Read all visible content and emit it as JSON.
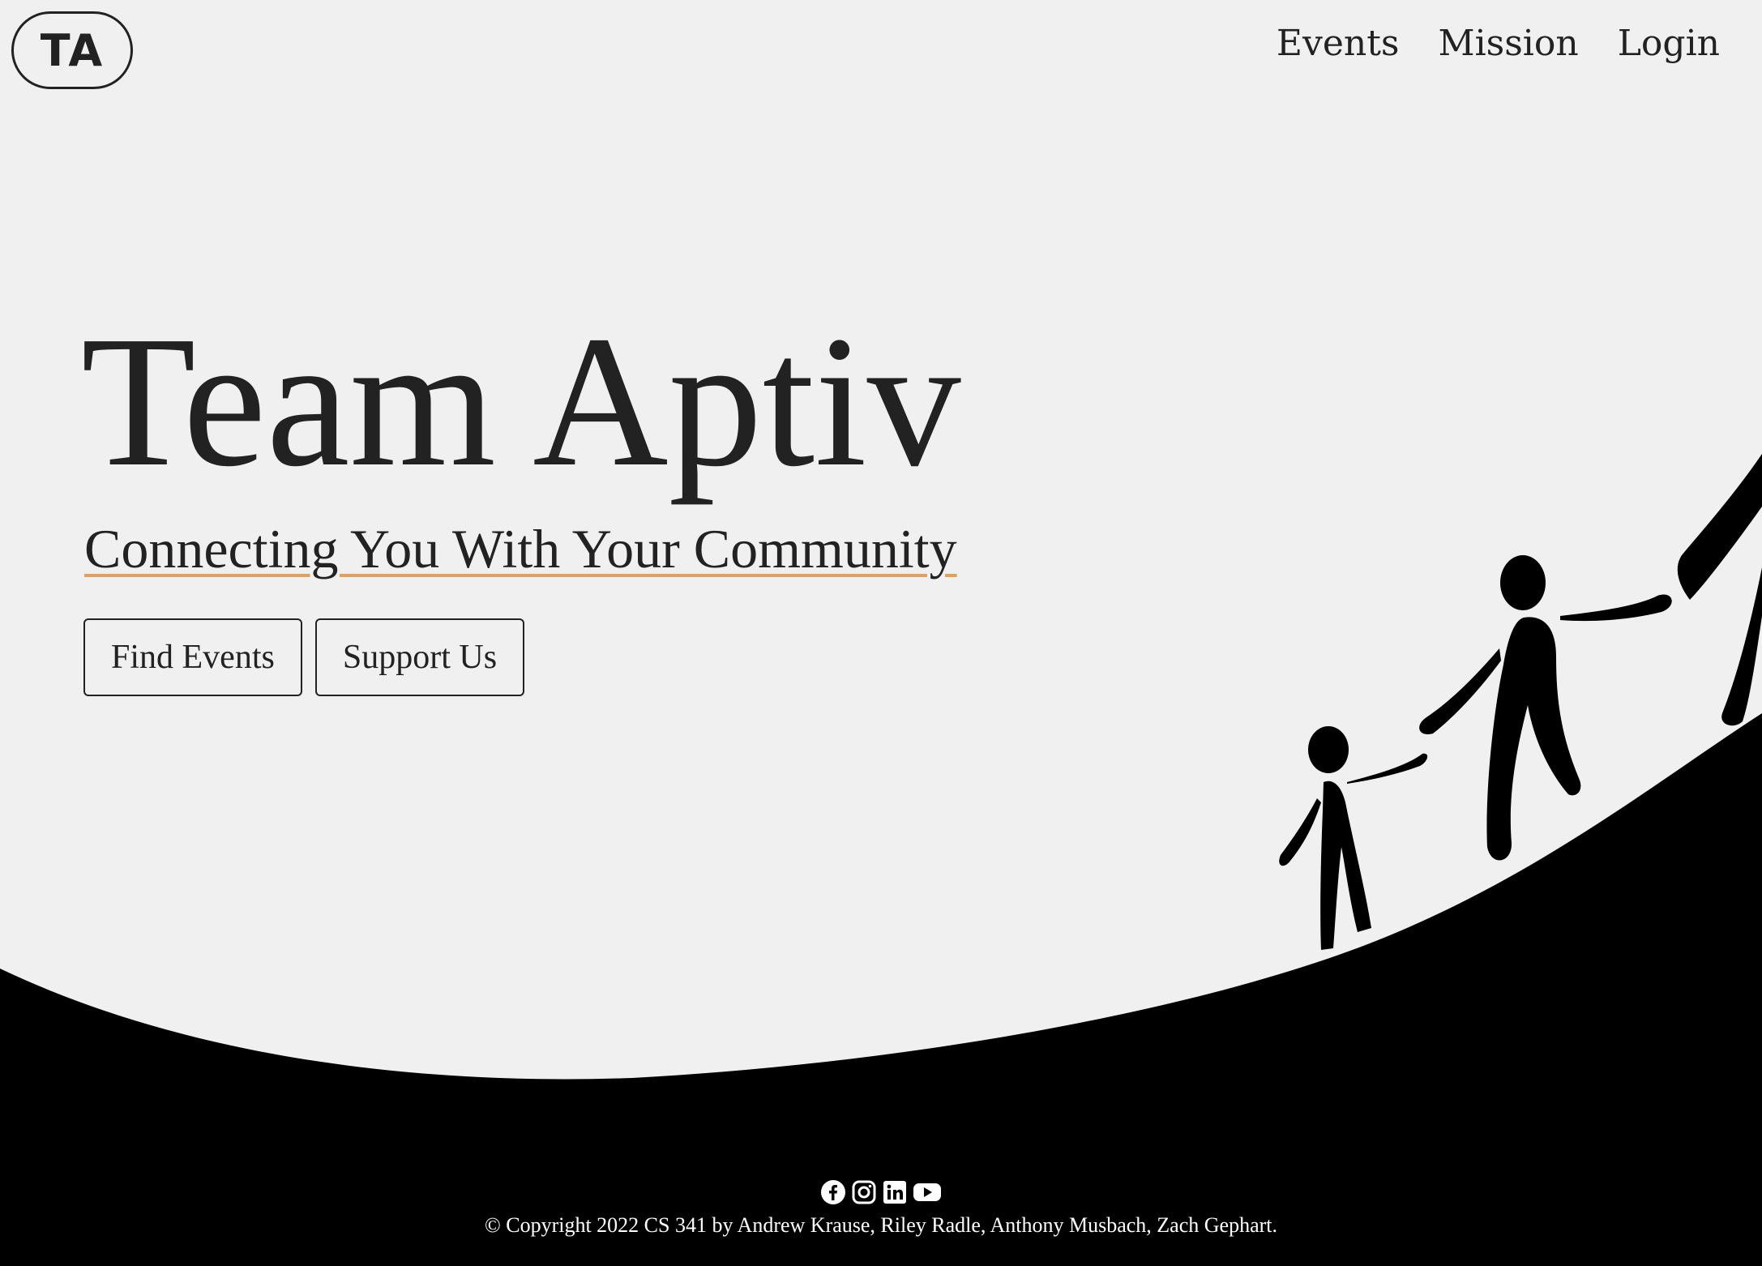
{
  "header": {
    "logo_text": "TA",
    "nav": [
      {
        "label": "Events"
      },
      {
        "label": "Mission"
      },
      {
        "label": "Login"
      }
    ]
  },
  "hero": {
    "title": "Team Aptiv",
    "subtitle": "Connecting You With Your Community",
    "buttons": [
      {
        "label": "Find Events"
      },
      {
        "label": "Support Us"
      }
    ]
  },
  "footer": {
    "socials": [
      "facebook-icon",
      "instagram-icon",
      "linkedin-icon",
      "youtube-icon"
    ],
    "copyright": "© Copyright 2022 CS 341 by Andrew Krause, Riley Radle, Anthony Musbach, Zach Gephart."
  },
  "colors": {
    "background": "#f0f0f0",
    "text": "#222222",
    "accent_underline": "#e0a060",
    "footer_bg": "#000000"
  }
}
